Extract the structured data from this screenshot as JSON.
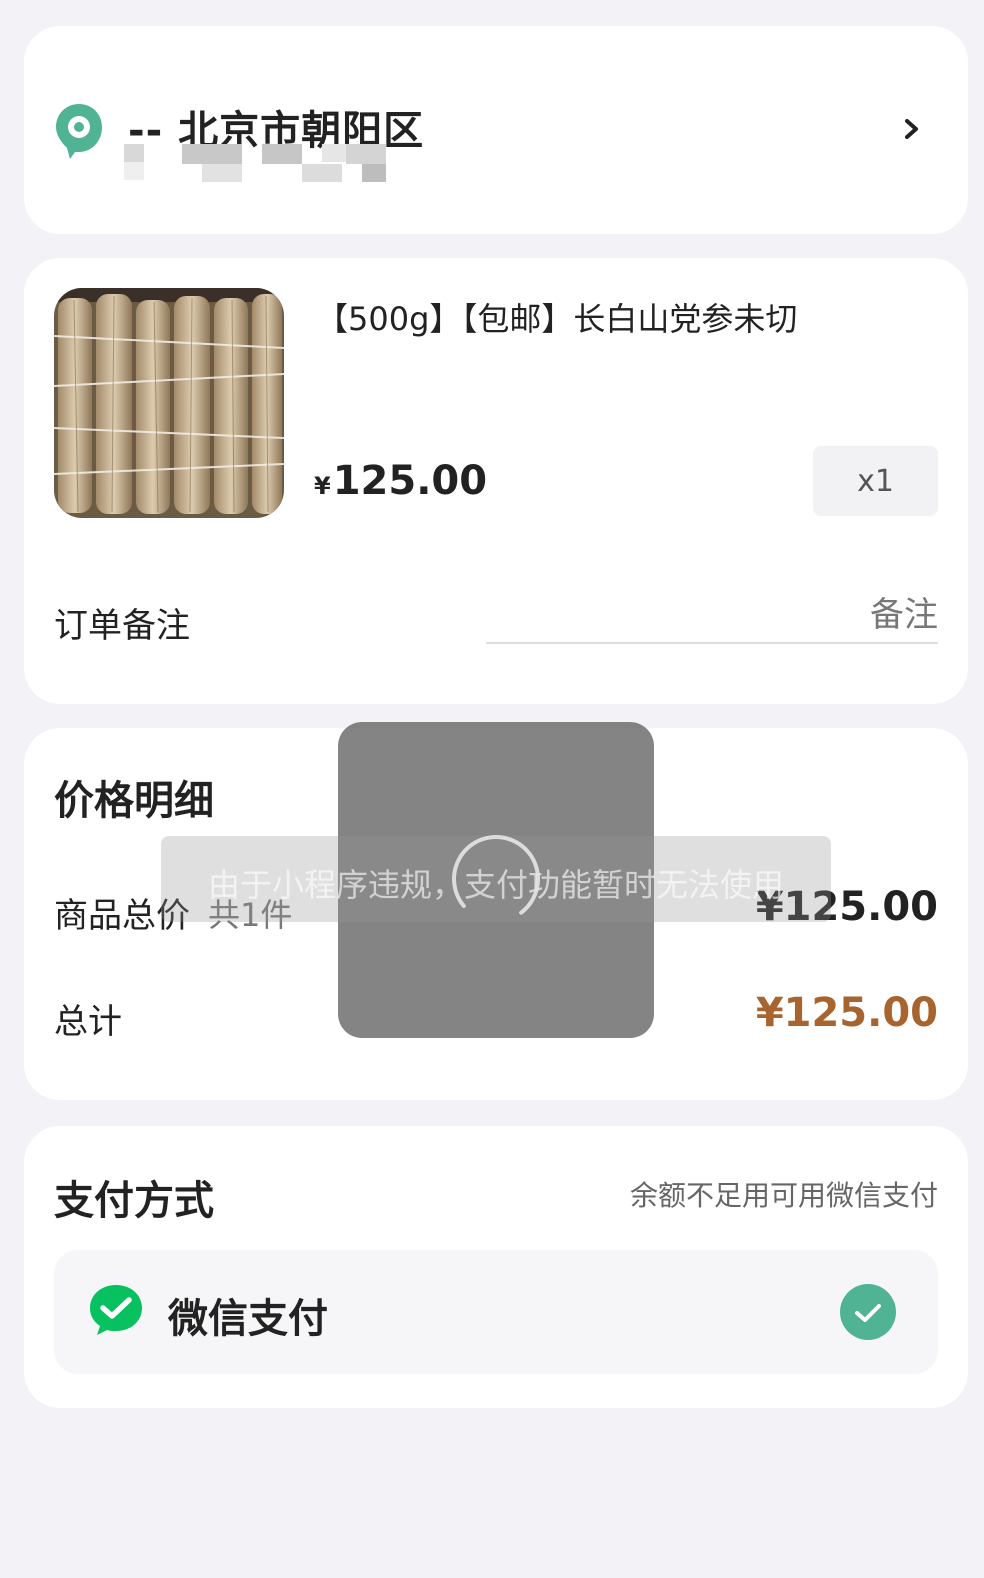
{
  "address": {
    "title": "-- 北京市朝阳区",
    "icon": "location-pin-icon",
    "chevron_icon": "chevron-right-icon"
  },
  "product": {
    "title": "【500g】【包邮】长白山党参未切",
    "currency": "¥",
    "price": "125.00",
    "quantity": "x1",
    "remark_label": "订单备注",
    "remark_placeholder": "备注"
  },
  "price_detail": {
    "title": "价格明细",
    "subtotal_label": "商品总价",
    "item_count": "共1件",
    "subtotal_value": "¥125.00",
    "total_label": "总计",
    "total_value": "¥125.00"
  },
  "payment": {
    "title": "支付方式",
    "note": "余额不足用可用微信支付",
    "method_name": "微信支付",
    "method_icon": "wechat-pay-icon",
    "selected_icon": "check-icon"
  },
  "overlay": {
    "toast_message": "由于小程序违规，支付功能暂时无法使用",
    "spinner_icon": "loading-spinner-icon"
  },
  "colors": {
    "background": "#f3f2f6",
    "accent_green": "#4fb394",
    "total_price": "#a8642e",
    "wechat_green": "#07c160"
  }
}
